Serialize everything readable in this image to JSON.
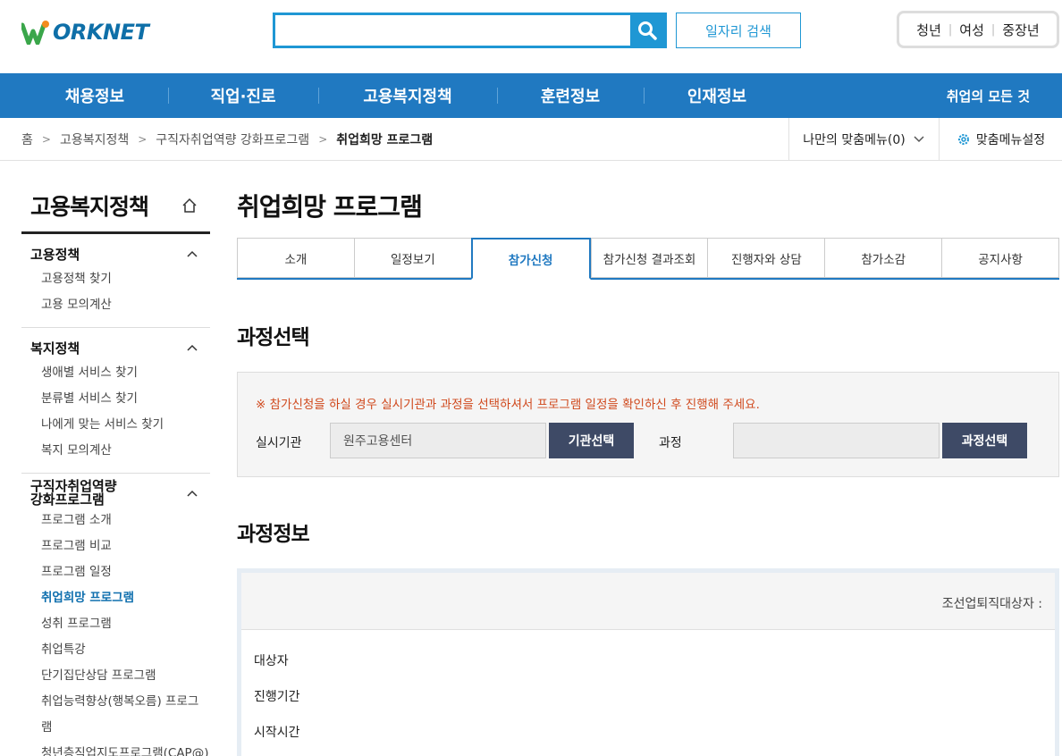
{
  "header": {
    "logo_text": "ORKNET",
    "search_placeholder": "",
    "job_search_label": "일자리 검색",
    "user_tabs": [
      "청년",
      "여성",
      "중장년"
    ]
  },
  "gnb": {
    "items": [
      "채용정보",
      "직업·진로",
      "고용복지정책",
      "훈련정보",
      "인재정보"
    ],
    "all_label": "취업의 모든 것"
  },
  "breadcrumb": {
    "items": [
      "홈",
      "고용복지정책",
      "구직자취업역량 강화프로그램",
      "취업희망 프로그램"
    ],
    "my_menu_label": "나만의 맞춤메뉴(0)",
    "menu_setting_label": "맞춤메뉴설정"
  },
  "sidebar": {
    "title": "고용복지정책",
    "groups": [
      {
        "label": "고용정책",
        "links": [
          "고용정책 찾기",
          "고용 모의계산"
        ]
      },
      {
        "label": "복지정책",
        "links": [
          "생애별 서비스 찾기",
          "분류별 서비스 찾기",
          "나에게 맞는 서비스 찾기",
          "복지 모의계산"
        ]
      },
      {
        "label_line1": "구직자취업역량",
        "label_line2": "강화프로그램",
        "links": [
          "프로그램 소개",
          "프로그램 비교",
          "프로그램 일정",
          "취업희망 프로그램",
          "성취 프로그램",
          "취업특강",
          "단기집단상담 프로그램",
          "취업능력향상(행복오름) 프로그",
          "램",
          "청년층직업지도프로그램(CAP@)"
        ]
      }
    ]
  },
  "main": {
    "title": "취업희망 프로그램",
    "tabs": [
      "소개",
      "일정보기",
      "참가신청",
      "참가신청 결과조회",
      "진행자와 상담",
      "참가소감",
      "공지사항"
    ],
    "active_tab": 2,
    "section1_title": "과정선택",
    "notice": "※ 참가신청을 하실 경우 실시기관과 과정을 선택하셔서 프로그램 일정을 확인하신 후 진행해 주세요.",
    "agency_label": "실시기관",
    "agency_value": "원주고용센터",
    "agency_button": "기관선택",
    "course_label": "과정",
    "course_value": "",
    "course_button": "과정선택",
    "section2_title": "과정정보",
    "info_head": "조선업퇴직대상자 :",
    "info_rows": [
      "대상자",
      "진행기간",
      "시작시간"
    ]
  },
  "colors": {
    "brand_blue": "#2079c1",
    "search_blue": "#1f97d4",
    "notice_orange": "#d0491d",
    "dark_button": "#3e4a66",
    "active_link": "#0f6fae"
  }
}
